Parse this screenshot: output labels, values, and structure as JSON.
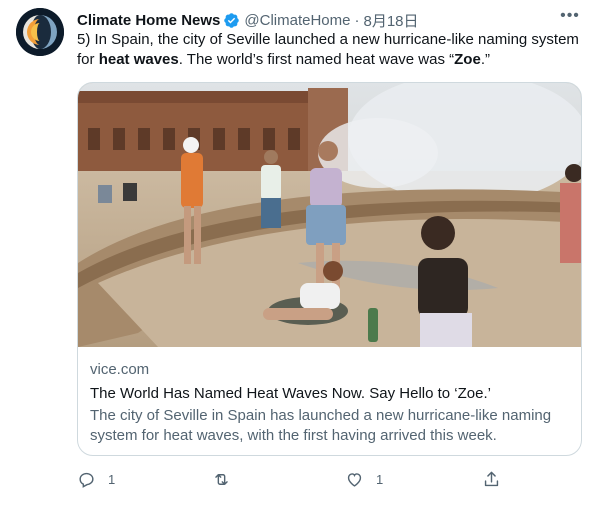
{
  "tweet": {
    "author_name": "Climate Home News",
    "handle": "@ClimateHome",
    "separator": "·",
    "date": "8月18日",
    "text_prefix": "5) In Spain, the city of Seville launched a new hurricane-like naming system for ",
    "text_bold1": "heat waves",
    "text_middle": ". The world’s first named heat wave was “",
    "text_bold2": "Zoe",
    "text_suffix": ".”",
    "card": {
      "domain": "vice.com",
      "title": "The World Has Named Heat Waves Now. Say Hello to ‘Zoe.’",
      "description": "The city of Seville in Spain has launched a new hurricane-like naming system for heat waves, with the first having arrived this week."
    },
    "actions": {
      "reply_count": "1",
      "retweet_count": "",
      "like_count": "1"
    }
  },
  "colors": {
    "verified": "#1d9bf0",
    "secondary_text": "#536471",
    "border": "#cfd9de",
    "avatar_bg": "#0d1b2a"
  },
  "icons": [
    "avatar-logo",
    "verified-badge-icon",
    "more-icon",
    "reply-icon",
    "retweet-icon",
    "like-icon",
    "share-icon"
  ]
}
